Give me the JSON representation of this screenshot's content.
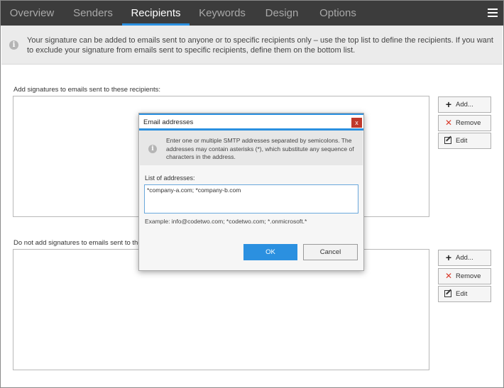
{
  "tabs": [
    {
      "label": "Overview",
      "active": false
    },
    {
      "label": "Senders",
      "active": false
    },
    {
      "label": "Recipients",
      "active": true
    },
    {
      "label": "Keywords",
      "active": false
    },
    {
      "label": "Design",
      "active": false
    },
    {
      "label": "Options",
      "active": false
    }
  ],
  "info": {
    "icon": "info-icon",
    "text": "Your signature can be added to emails sent to anyone or to specific recipients only – use the top list to define the recipients. If you want to exclude your signature from emails sent to specific recipients, define them on the bottom list."
  },
  "add_section": {
    "label": "Add signatures to emails sent to these recipients:",
    "buttons": {
      "add": "Add...",
      "remove": "Remove",
      "edit": "Edit"
    }
  },
  "exclude_section": {
    "label": "Do not add signatures to emails sent to these recipients:",
    "buttons": {
      "add": "Add...",
      "remove": "Remove",
      "edit": "Edit"
    }
  },
  "dialog": {
    "title": "Email addresses",
    "close": "x",
    "info_text": "Enter one or multiple SMTP addresses separated by semicolons. The addresses may contain asterisks (*), which substitute any sequence of characters in the address.",
    "list_label": "List of addresses:",
    "input_value": "*company-a.com; *company-b.com",
    "example": "Example: info@codetwo.com; *codetwo.com; *.onmicrosoft.*",
    "ok": "OK",
    "cancel": "Cancel"
  },
  "colors": {
    "accent": "#2b90e0",
    "topbar": "#3c3c3c",
    "remove_icon": "#d93a2b",
    "close_button": "#c0392b"
  }
}
